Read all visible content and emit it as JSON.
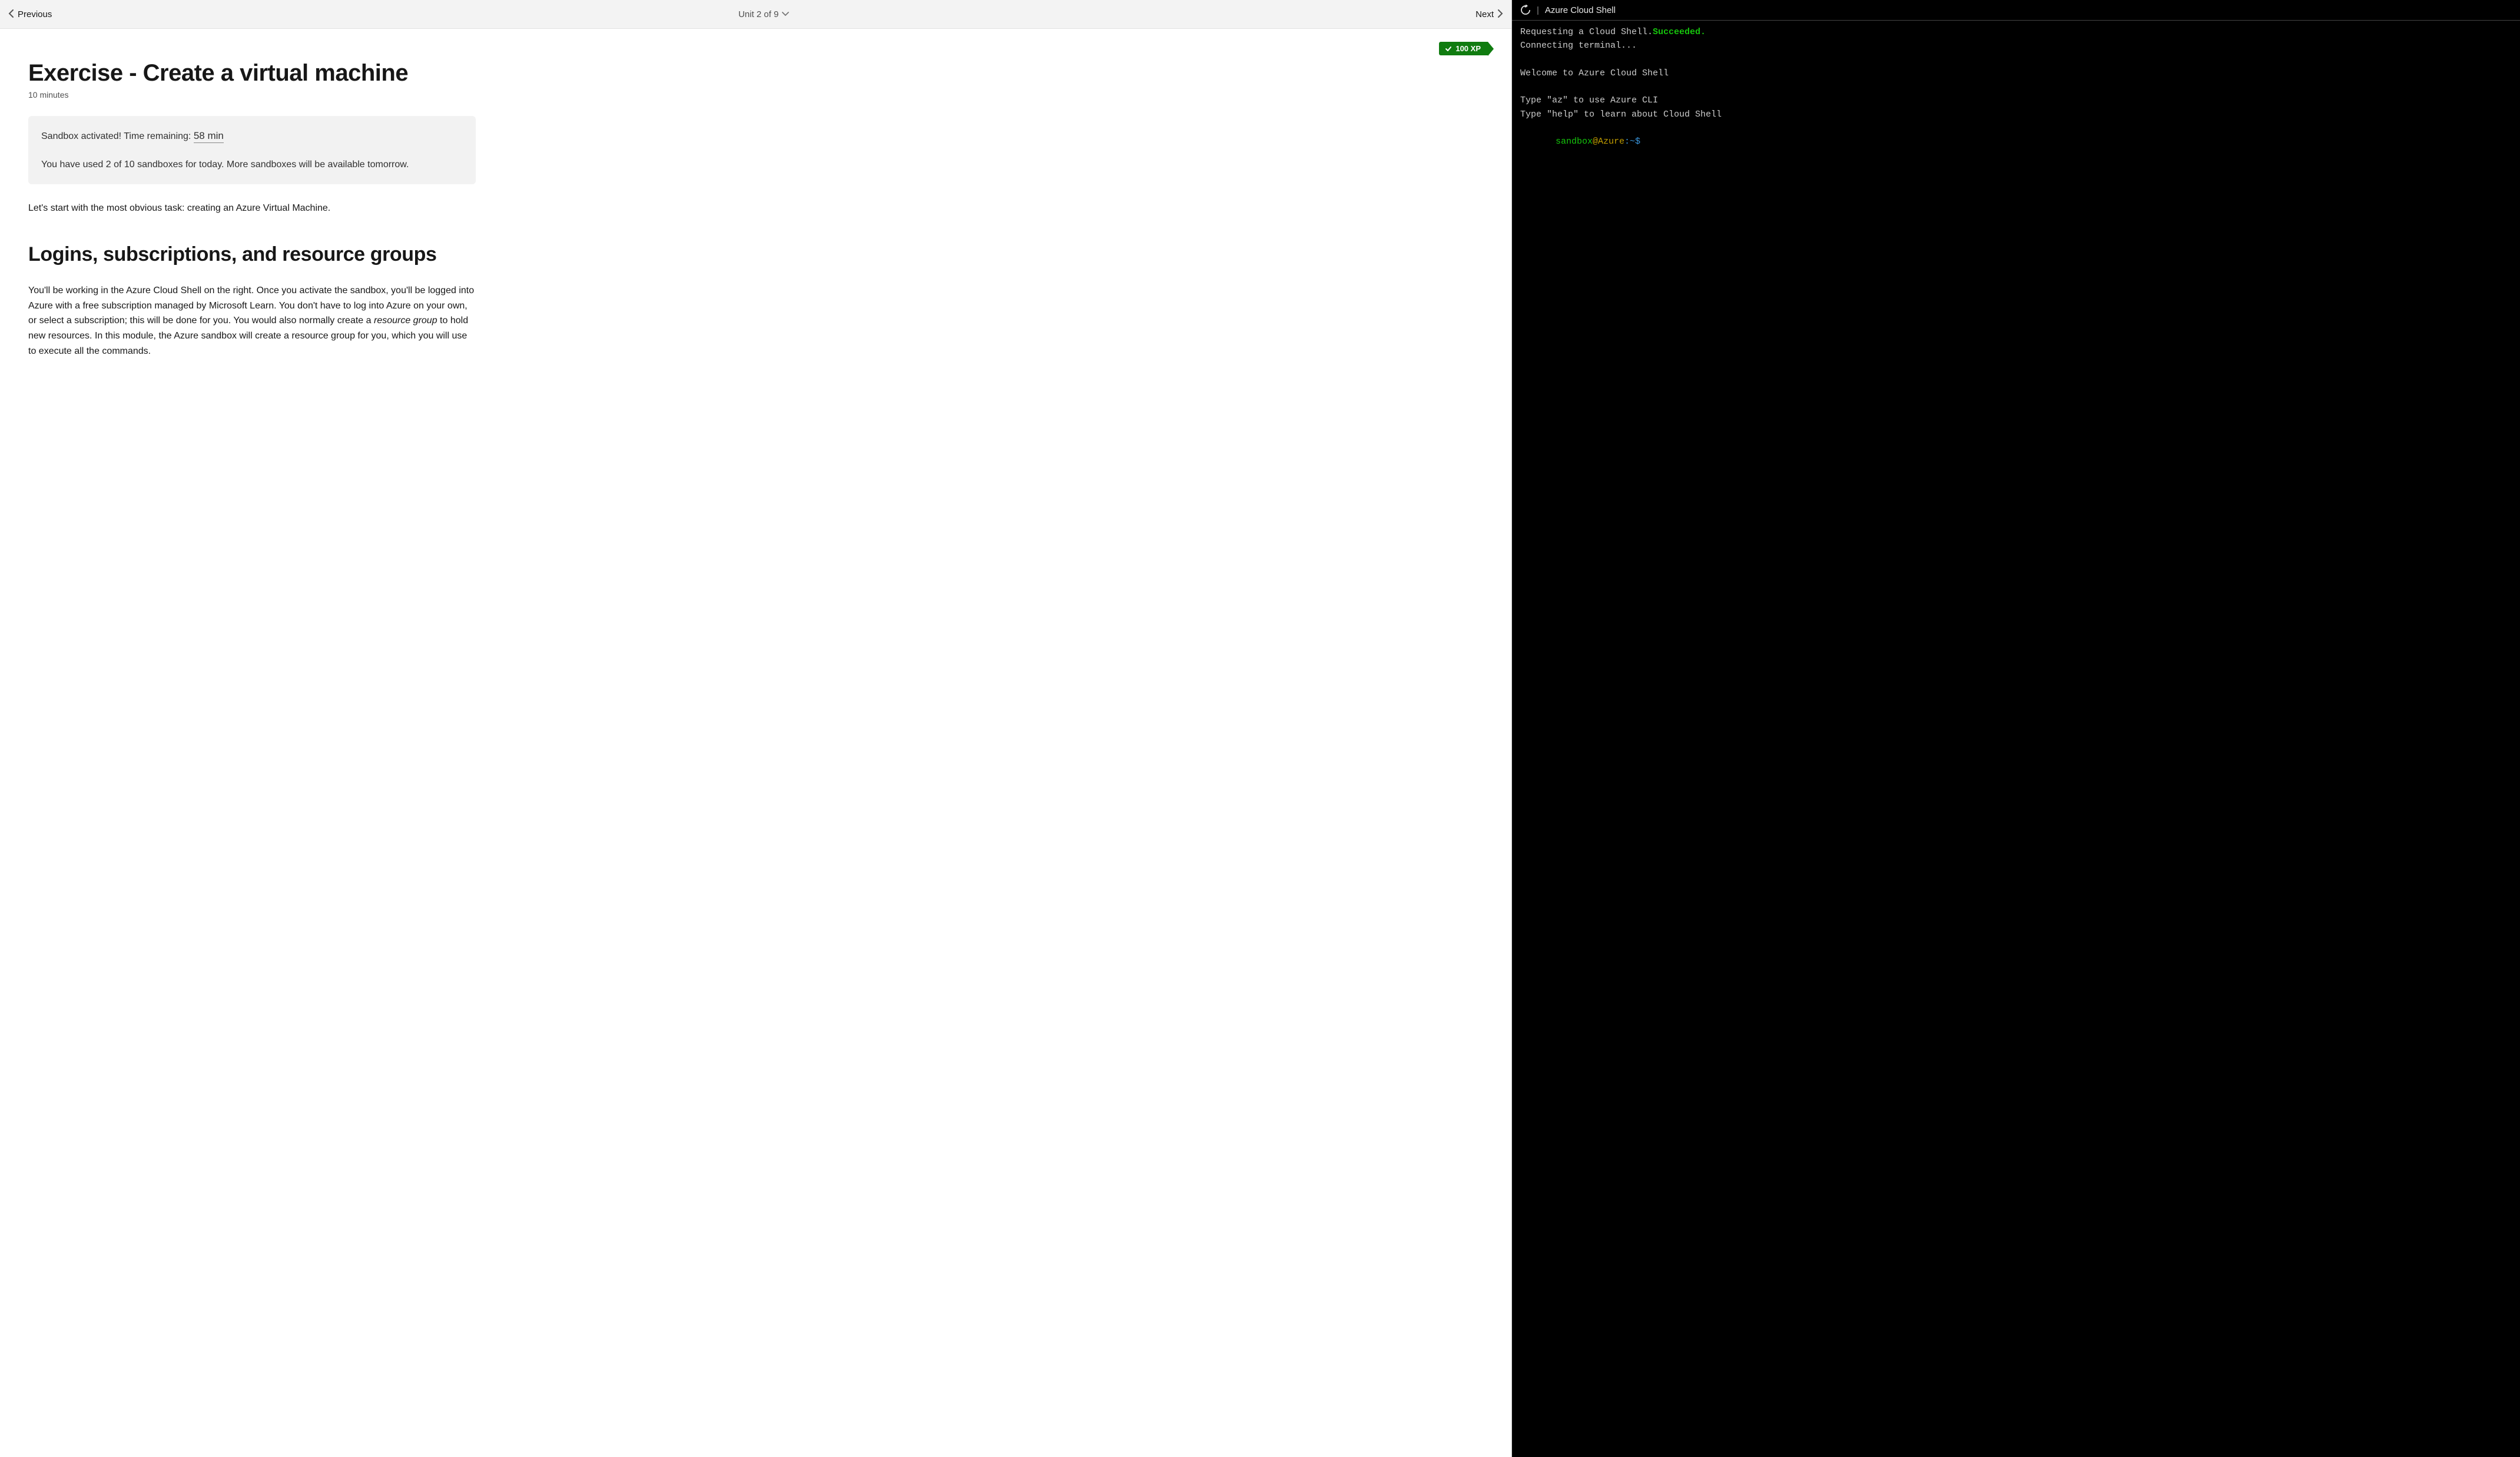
{
  "nav": {
    "prev_label": "Previous",
    "unit_label": "Unit 2 of 9",
    "next_label": "Next"
  },
  "xp_badge": {
    "text": "100 XP"
  },
  "page": {
    "title": "Exercise - Create a virtual machine",
    "duration": "10 minutes"
  },
  "sandbox": {
    "activated_prefix": "Sandbox activated! Time remaining: ",
    "time_remaining": "58 min",
    "usage_text": "You have used 2 of 10 sandboxes for today. More sandboxes will be available tomorrow."
  },
  "intro_para": "Let's start with the most obvious task: creating an Azure Virtual Machine.",
  "section2_title": "Logins, subscriptions, and resource groups",
  "section2_para_before_em": "You'll be working in the Azure Cloud Shell on the right. Once you activate the sandbox, you'll be logged into Azure with a free subscription managed by Microsoft Learn. You don't have to log into Azure on your own, or select a subscription; this will be done for you. You would also normally create a ",
  "section2_para_em": "resource group",
  "section2_para_after_em": " to hold new resources. In this module, the Azure sandbox will create a resource group for you, which you will use to execute all the commands.",
  "terminal": {
    "title": "Azure Cloud Shell",
    "lines": {
      "req_prefix": "Requesting a Cloud Shell.",
      "req_status": "Succeeded.",
      "connecting": "Connecting terminal...",
      "welcome": "Welcome to Azure Cloud Shell",
      "tip1": "Type \"az\" to use Azure CLI",
      "tip2": "Type \"help\" to learn about Cloud Shell"
    },
    "prompt": {
      "user": "sandbox",
      "host": "@Azure",
      "path": ":~$"
    }
  }
}
